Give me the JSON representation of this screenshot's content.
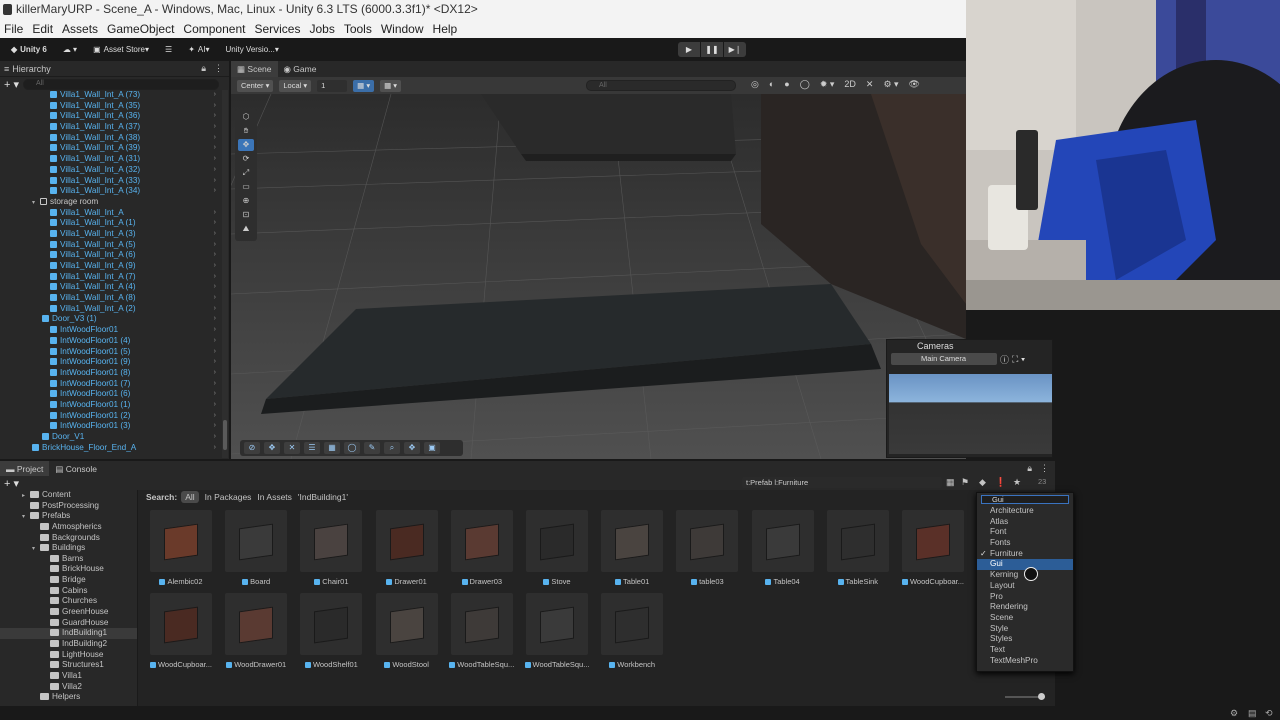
{
  "window": {
    "title": "killerMaryURP - Scene_A - Windows, Mac, Linux - Unity 6.3 LTS (6000.3.3f1)* <DX12>"
  },
  "menu": [
    "File",
    "Edit",
    "Assets",
    "GameObject",
    "Component",
    "Services",
    "Jobs",
    "Tools",
    "Window",
    "Help"
  ],
  "toolbar": {
    "unity": "Unity 6",
    "asset_store": "Asset Store",
    "ai": "AI",
    "version": "Unity Versio..."
  },
  "play": {
    "play": "▶",
    "pause": "❚❚",
    "step": "▶❘"
  },
  "hierarchy": {
    "title": "Hierarchy",
    "search_placeholder": "All",
    "rows": [
      {
        "label": "Villa1_Wall_Int_A (73)",
        "type": "prefab"
      },
      {
        "label": "Villa1_Wall_Int_A (35)",
        "type": "prefab"
      },
      {
        "label": "Villa1_Wall_Int_A (36)",
        "type": "prefab"
      },
      {
        "label": "Villa1_Wall_Int_A (37)",
        "type": "prefab"
      },
      {
        "label": "Villa1_Wall_Int_A (38)",
        "type": "prefab"
      },
      {
        "label": "Villa1_Wall_Int_A (39)",
        "type": "prefab"
      },
      {
        "label": "Villa1_Wall_Int_A (31)",
        "type": "prefab"
      },
      {
        "label": "Villa1_Wall_Int_A (32)",
        "type": "prefab"
      },
      {
        "label": "Villa1_Wall_Int_A (33)",
        "type": "prefab"
      },
      {
        "label": "Villa1_Wall_Int_A (34)",
        "type": "prefab"
      },
      {
        "label": "storage room",
        "type": "group"
      },
      {
        "label": "Villa1_Wall_Int_A",
        "type": "prefab"
      },
      {
        "label": "Villa1_Wall_Int_A (1)",
        "type": "prefab"
      },
      {
        "label": "Villa1_Wall_Int_A (3)",
        "type": "prefab"
      },
      {
        "label": "Villa1_Wall_Int_A (5)",
        "type": "prefab"
      },
      {
        "label": "Villa1_Wall_Int_A (6)",
        "type": "prefab"
      },
      {
        "label": "Villa1_Wall_Int_A (9)",
        "type": "prefab"
      },
      {
        "label": "Villa1_Wall_Int_A (7)",
        "type": "prefab"
      },
      {
        "label": "Villa1_Wall_Int_A (4)",
        "type": "prefab"
      },
      {
        "label": "Villa1_Wall_Int_A (8)",
        "type": "prefab"
      },
      {
        "label": "Villa1_Wall_Int_A (2)",
        "type": "prefab"
      },
      {
        "label": "Door_V3 (1)",
        "type": "prefab"
      },
      {
        "label": "IntWoodFloor01",
        "type": "prefab"
      },
      {
        "label": "IntWoodFloor01 (4)",
        "type": "prefab"
      },
      {
        "label": "IntWoodFloor01 (5)",
        "type": "prefab"
      },
      {
        "label": "IntWoodFloor01 (9)",
        "type": "prefab"
      },
      {
        "label": "IntWoodFloor01 (8)",
        "type": "prefab"
      },
      {
        "label": "IntWoodFloor01 (7)",
        "type": "prefab"
      },
      {
        "label": "IntWoodFloor01 (6)",
        "type": "prefab"
      },
      {
        "label": "IntWoodFloor01 (1)",
        "type": "prefab"
      },
      {
        "label": "IntWoodFloor01 (2)",
        "type": "prefab"
      },
      {
        "label": "IntWoodFloor01 (3)",
        "type": "prefab"
      },
      {
        "label": "Door_V1",
        "type": "prefab"
      },
      {
        "label": "BrickHouse_Floor_End_A",
        "type": "prefab"
      }
    ]
  },
  "scene": {
    "tab_scene": "Scene",
    "tab_game": "Game",
    "pivot": "Center",
    "space": "Local",
    "grid_value": "1",
    "search_placeholder": "All",
    "overlay_title": "Cameras",
    "camera_select": "Main Camera"
  },
  "bottom": {
    "tab_project": "Project",
    "tab_console": "Console",
    "count": "23"
  },
  "project": {
    "search_value": "t:Prefab l:Furniture",
    "search_label": "Search:",
    "search_all": "All",
    "search_packages": "In Packages",
    "search_assets": "In Assets",
    "search_folder": "'IndBuilding1'",
    "tree": [
      {
        "label": "Content",
        "fold": "▸",
        "indent": 0
      },
      {
        "label": "PostProcessing",
        "fold": "",
        "indent": 0
      },
      {
        "label": "Prefabs",
        "fold": "▾",
        "indent": 0
      },
      {
        "label": "Atmospherics",
        "fold": "",
        "indent": 1
      },
      {
        "label": "Backgrounds",
        "fold": "",
        "indent": 1
      },
      {
        "label": "Buildings",
        "fold": "▾",
        "indent": 1
      },
      {
        "label": "Barns",
        "fold": "",
        "indent": 2
      },
      {
        "label": "BrickHouse",
        "fold": "",
        "indent": 2
      },
      {
        "label": "Bridge",
        "fold": "",
        "indent": 2
      },
      {
        "label": "Cabins",
        "fold": "",
        "indent": 2
      },
      {
        "label": "Churches",
        "fold": "",
        "indent": 2
      },
      {
        "label": "GreenHouse",
        "fold": "",
        "indent": 2
      },
      {
        "label": "GuardHouse",
        "fold": "",
        "indent": 2
      },
      {
        "label": "IndBuilding1",
        "fold": "",
        "indent": 2,
        "selected": true
      },
      {
        "label": "IndBuilding2",
        "fold": "",
        "indent": 2
      },
      {
        "label": "LightHouse",
        "fold": "",
        "indent": 2
      },
      {
        "label": "Structures1",
        "fold": "",
        "indent": 2
      },
      {
        "label": "Villa1",
        "fold": "",
        "indent": 2
      },
      {
        "label": "Villa2",
        "fold": "",
        "indent": 2
      },
      {
        "label": "Helpers",
        "fold": "",
        "indent": 1
      }
    ],
    "assets_row1": [
      "Alembic02",
      "Board",
      "Chair01",
      "Drawer01",
      "Drawer03",
      "Stove",
      "Table01",
      "table03",
      "Table04",
      "TableSink",
      "WoodCupboar..."
    ],
    "assets_row2": [
      "WoodCupboar...",
      "WoodDrawer01",
      "WoodShelf01",
      "WoodStool",
      "WoodTableSqu...",
      "WoodTableSqu...",
      "Workbench"
    ]
  },
  "label_dropdown": {
    "input": "Gui",
    "items": [
      {
        "label": "Architecture"
      },
      {
        "label": "Atlas"
      },
      {
        "label": "Font"
      },
      {
        "label": "Fonts"
      },
      {
        "label": "Furniture",
        "checked": true
      },
      {
        "label": "Gui",
        "highlight": true
      },
      {
        "label": "Kerning"
      },
      {
        "label": "Layout"
      },
      {
        "label": "Pro"
      },
      {
        "label": "Rendering"
      },
      {
        "label": "Scene"
      },
      {
        "label": "Style"
      },
      {
        "label": "Styles"
      },
      {
        "label": "Text"
      },
      {
        "label": "TextMeshPro"
      }
    ]
  },
  "colors": {
    "prefab_blue": "#58b3ef",
    "selection_blue": "#2c5d97",
    "panel": "#282828",
    "scene_bg": "#3b3b3b"
  }
}
